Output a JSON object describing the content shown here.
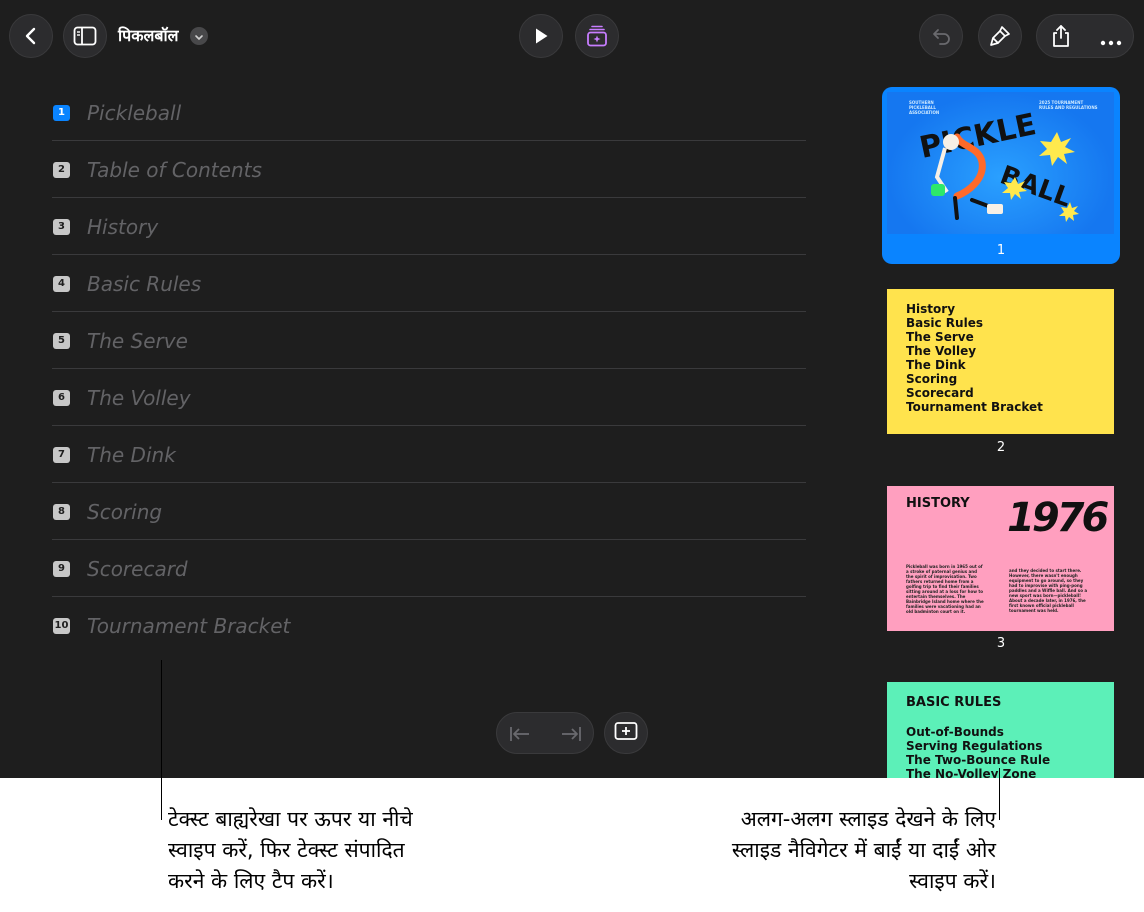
{
  "toolbar": {
    "doc_title": "पिकलबॉल",
    "icons": [
      "back-chevron-icon",
      "sidebar-icon",
      "chevron-down-icon",
      "play-icon",
      "animate-icon",
      "undo-icon",
      "format-brush-icon",
      "share-icon",
      "more-icon"
    ]
  },
  "outline": {
    "items": [
      {
        "num": "1",
        "label": "Pickleball"
      },
      {
        "num": "2",
        "label": "Table of Contents"
      },
      {
        "num": "3",
        "label": "History"
      },
      {
        "num": "4",
        "label": "Basic Rules"
      },
      {
        "num": "5",
        "label": "The Serve"
      },
      {
        "num": "6",
        "label": "The Volley"
      },
      {
        "num": "7",
        "label": "The Dink"
      },
      {
        "num": "8",
        "label": "Scoring"
      },
      {
        "num": "9",
        "label": "Scorecard"
      },
      {
        "num": "10",
        "label": "Tournament Bracket"
      }
    ]
  },
  "navigator": {
    "slides": [
      {
        "num": "1",
        "big_text": [
          "PICKLE",
          "BALL"
        ],
        "small_left": "SOUTHERN PICKLEBALL ASSOCIATION",
        "small_right": "2025 TOURNAMENT RULES AND REGULATIONS"
      },
      {
        "num": "2",
        "lines": [
          "History",
          "Basic Rules",
          "The Serve",
          "The Volley",
          "The Dink",
          "Scoring",
          "Scorecard",
          "Tournament Bracket"
        ]
      },
      {
        "num": "3",
        "heading": "HISTORY",
        "year": "1976",
        "para_left": "Pickleball was born in 1965 out of a stroke of paternal genius and the spirit of improvisation. Two fathers returned home from a golfing trip to find their families sitting around at a loss for how to entertain themselves. The Bainbridge Island home where the families were vacationing had an old badminton court on it.",
        "para_right": "and they decided to start there. However, there wasn't enough equipment to go around, so they had to improvise with ping-pong paddles and a Wiffle ball. And so a new sport was born—pickleball! About a decade later, in 1976, the first known official pickleball tournament was held."
      },
      {
        "num": "",
        "heading": "BASIC RULES",
        "lines": [
          "Out-of-Bounds",
          "Serving Regulations",
          "The Two-Bounce Rule",
          "The No-Volley Zone"
        ]
      }
    ]
  },
  "captions": {
    "left": [
      "टेक्स्ट बाह्यरेखा पर ऊपर या नीचे",
      "स्वाइप करें, फिर टेक्स्ट संपादित",
      "करने के लिए टैप करें।"
    ],
    "right": [
      "अलग-अलग स्लाइड देखने के लिए",
      "स्लाइड नैविगेटर में बाईं या दाईं ओर",
      "स्वाइप करें।"
    ]
  }
}
